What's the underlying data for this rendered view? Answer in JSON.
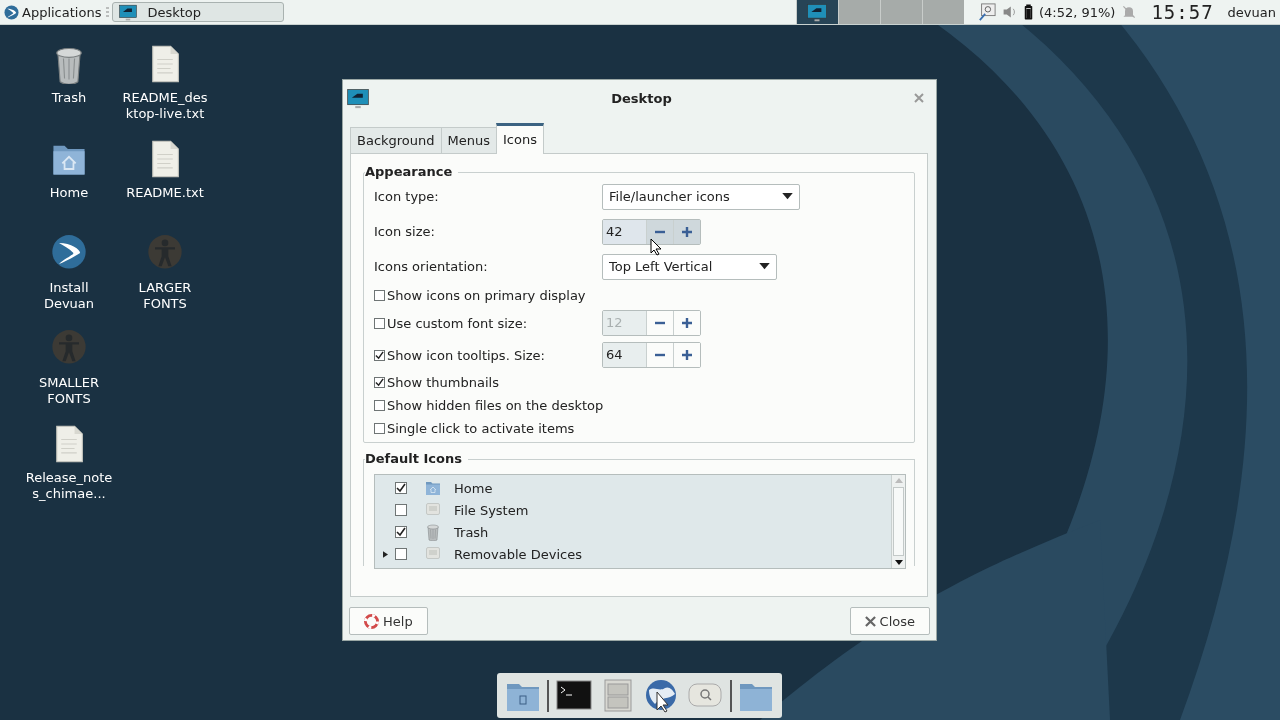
{
  "top_panel": {
    "menu": "Applications",
    "tasks": [
      {
        "title": "Desktop",
        "selected": false
      }
    ],
    "workspaces": [
      {
        "selected": true
      },
      {
        "selected": false
      },
      {
        "selected": false
      },
      {
        "selected": false
      }
    ],
    "battery": "(4:52, 91%)",
    "clock": "15:57",
    "user": "devuan"
  },
  "desktop_icons": [
    {
      "label": "Trash",
      "kind": "trash"
    },
    {
      "label": "Home",
      "kind": "home"
    },
    {
      "label": "Install Devuan",
      "kind": "devuan"
    },
    {
      "label": "SMALLER FONTS",
      "kind": "accessibility"
    },
    {
      "label": "Release_notes_chimae...",
      "kind": "file"
    },
    {
      "label": "README_desktop-live.txt",
      "kind": "file"
    },
    {
      "label": "README.txt",
      "kind": "file"
    },
    {
      "label": "LARGER FONTS",
      "kind": "accessibility"
    }
  ],
  "dialog": {
    "title": "Desktop",
    "tabs": [
      {
        "label": "Background",
        "selected": false
      },
      {
        "label": "Menus",
        "selected": false
      },
      {
        "label": "Icons",
        "selected": true
      }
    ],
    "appearance": {
      "title": "Appearance",
      "rows": [
        {
          "kind": "combo",
          "label": "Icon type:",
          "value": "File/launcher icons"
        },
        {
          "kind": "spin",
          "label": "Icon size:",
          "value": "42",
          "disabled": false
        },
        {
          "kind": "combo",
          "label": "Icons orientation:",
          "value": "Top Left Vertical"
        },
        {
          "kind": "check",
          "label": "Show icons on primary display",
          "checked": false
        },
        {
          "kind": "checkspin",
          "label": "Use custom font size:",
          "checked": false,
          "value": "12",
          "disabled": true
        },
        {
          "kind": "checkspin",
          "label": "Show icon tooltips. Size:",
          "checked": true,
          "value": "64",
          "disabled": false
        },
        {
          "kind": "check",
          "label": "Show thumbnails",
          "checked": true
        },
        {
          "kind": "check",
          "label": "Show hidden files on the desktop",
          "checked": false
        },
        {
          "kind": "check",
          "label": "Single click to activate items",
          "checked": false
        }
      ]
    },
    "default_icons": {
      "title": "Default Icons",
      "items": [
        {
          "label": "Home",
          "checked": true,
          "kind": "home",
          "expander": false
        },
        {
          "label": "File System",
          "checked": false,
          "kind": "drive",
          "expander": false
        },
        {
          "label": "Trash",
          "checked": true,
          "kind": "trash",
          "expander": false
        },
        {
          "label": "Removable Devices",
          "checked": false,
          "kind": "drive",
          "expander": true
        }
      ]
    },
    "buttons": [
      {
        "label": "Help",
        "kind": "help"
      },
      {
        "label": "Close",
        "kind": "close"
      }
    ]
  },
  "dock": [
    {
      "kind": "folder-doc"
    },
    {
      "kind": "separator"
    },
    {
      "kind": "terminal"
    },
    {
      "kind": "cabinet"
    },
    {
      "kind": "globe"
    },
    {
      "kind": "search"
    },
    {
      "kind": "separator"
    },
    {
      "kind": "folder"
    }
  ]
}
